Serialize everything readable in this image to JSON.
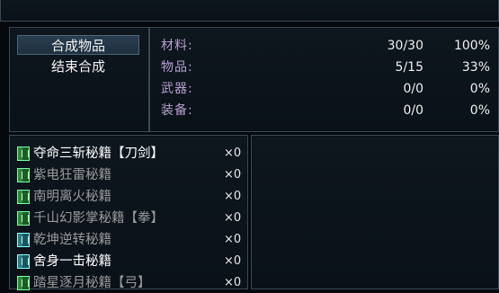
{
  "commands": {
    "synthesize": "合成物品",
    "end": "结束合成"
  },
  "stats": [
    {
      "label": "材料:",
      "value": "30/30",
      "percent": "100%"
    },
    {
      "label": "物品:",
      "value": "5/15",
      "percent": "33%"
    },
    {
      "label": "武器:",
      "value": "0/0",
      "percent": "0%"
    },
    {
      "label": "装备:",
      "value": "0/0",
      "percent": "0%"
    }
  ],
  "items": [
    {
      "name": "夺命三斩秘籍【刀剑】",
      "qty": "×0",
      "color": "#ffffff",
      "icon": "book-icon"
    },
    {
      "name": "紫电狂雷秘籍",
      "qty": "×0",
      "color": "#9a9a9a",
      "icon": "book-icon"
    },
    {
      "name": "南明离火秘籍",
      "qty": "×0",
      "color": "#9a9a9a",
      "icon": "book-icon"
    },
    {
      "name": "千山幻影掌秘籍【拳】",
      "qty": "×0",
      "color": "#9a9a9a",
      "icon": "book-icon"
    },
    {
      "name": "乾坤逆转秘籍",
      "qty": "×0",
      "color": "#9a9a9a",
      "icon": "book-icon-teal"
    },
    {
      "name": "舍身一击秘籍",
      "qty": "×0",
      "color": "#ffffff",
      "icon": "book-icon-teal"
    },
    {
      "name": "踏星逐月秘籍【弓】",
      "qty": "×0",
      "color": "#9a9a9a",
      "icon": "book-icon"
    }
  ]
}
